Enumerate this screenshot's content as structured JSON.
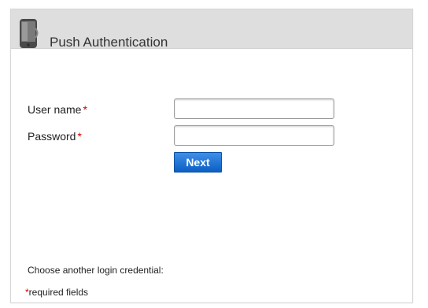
{
  "header": {
    "title": "Push Authentication",
    "icon": "mobile-phone-icon"
  },
  "form": {
    "username_label": "User name",
    "password_label": "Password",
    "required_mark": "*",
    "username_value": "",
    "password_value": "",
    "next_label": "Next"
  },
  "footer": {
    "other_credential": "Choose another login credential:",
    "required_mark": "*",
    "required_note": "required fields"
  },
  "colors": {
    "header_bg": "#dedede",
    "button_blue": "#1a6fd6",
    "required_red": "#cc0000"
  }
}
